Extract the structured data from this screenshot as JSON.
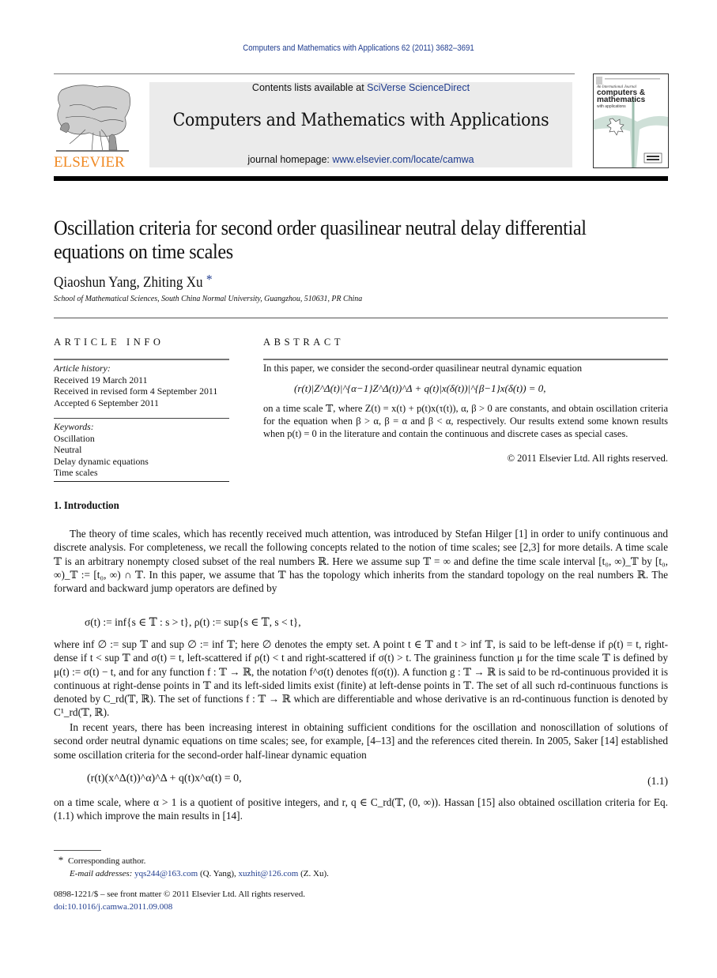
{
  "running_header": "Computers and Mathematics with Applications 62 (2011) 3682–3691",
  "publisher": {
    "logo_word": "ELSEVIER",
    "logo_color": "#f08a24"
  },
  "banner": {
    "contents_prefix": "Contents lists available at ",
    "contents_link": "SciVerse ScienceDirect",
    "journal_title": "Computers and Mathematics with Applications",
    "homepage_prefix": "journal homepage: ",
    "homepage_link": "www.elsevier.com/locate/camwa",
    "link_color": "#1f3c8f"
  },
  "cover": {
    "line1": "An International Journal",
    "line2": "computers &",
    "line3": "mathematics",
    "line4": "with applications",
    "badge": "ELECTRONIC ACCESS"
  },
  "article": {
    "title": "Oscillation criteria for second order quasilinear neutral delay differential equations on time scales",
    "authors": "Qiaoshun Yang, Zhiting Xu",
    "author_mark": "*",
    "affiliation": "School of Mathematical Sciences, South China Normal University, Guangzhou, 510631, PR China"
  },
  "article_info": {
    "heading": "ARTICLE INFO",
    "history_label": "Article history:",
    "history": [
      "Received 19 March 2011",
      "Received in revised form 4 September 2011",
      "Accepted 6 September 2011"
    ],
    "keywords_label": "Keywords:",
    "keywords": [
      "Oscillation",
      "Neutral",
      "Delay dynamic equations",
      "Time scales"
    ]
  },
  "abstract": {
    "heading": "ABSTRACT",
    "intro": "In this paper, we consider the second-order quasilinear neutral dynamic equation",
    "equation": "(r(t)|Z^Δ(t)|^{α−1}Z^Δ(t))^Δ + q(t)|x(δ(t))|^{β−1}x(δ(t)) = 0,",
    "body": "on a time scale 𝕋, where Z(t) = x(t) + p(t)x(τ(t)), α, β > 0 are constants, and obtain oscillation criteria for the equation when β > α, β = α and β < α, respectively. Our results extend some known results when p(t) = 0 in the literature and contain the continuous and discrete cases as special cases.",
    "copyright": "© 2011 Elsevier Ltd. All rights reserved."
  },
  "introduction": {
    "heading": "1.  Introduction",
    "para1": "The theory of time scales, which has recently received much attention, was introduced by Stefan Hilger [1] in order to unify continuous and discrete analysis. For completeness, we recall the following concepts related to the notion of time scales; see [2,3] for more details. A time scale 𝕋 is an arbitrary nonempty closed subset of the real numbers ℝ. Here we assume sup 𝕋 = ∞ and define the time scale interval [t₀, ∞)_𝕋 by [t₀, ∞)_𝕋 := [t₀, ∞) ∩ 𝕋. In this paper, we assume that 𝕋 has the topology which inherits from the standard topology on the real numbers ℝ. The forward and backward jump operators are defined by",
    "jump_equation": "σ(t) := inf{s ∈ 𝕋 : s > t},        ρ(t) := sup{s ∈ 𝕋, s < t},",
    "para2": "where inf ∅ := sup 𝕋 and sup ∅ := inf 𝕋; here ∅ denotes the empty set. A point t ∈ 𝕋 and t > inf 𝕋, is said to be left-dense if ρ(t) = t, right-dense if t < sup 𝕋 and σ(t) = t, left-scattered if ρ(t) < t and right-scattered if σ(t) > t. The graininess function μ for the time scale 𝕋 is defined by μ(t) := σ(t) − t, and for any function f : 𝕋 → ℝ, the notation f^σ(t) denotes f(σ(t)). A function g : 𝕋 → ℝ is said to be rd-continuous provided it is continuous at right-dense points in 𝕋 and its left-sided limits exist (finite) at left-dense points in 𝕋. The set of all such rd-continuous functions is denoted by C_rd(𝕋, ℝ). The set of functions f : 𝕋 → ℝ which are differentiable and whose derivative is an rd-continuous function is denoted by C¹_rd(𝕋, ℝ).",
    "para3": "In recent years, there has been increasing interest in obtaining sufficient conditions for the oscillation and nonoscillation of solutions of second order neutral dynamic equations on time scales; see, for example, [4–13] and the references cited therein. In 2005, Saker [14] established some oscillation criteria for the second-order half-linear dynamic equation",
    "equation_1_1": "(r(t)(x^Δ(t))^α)^Δ + q(t)x^α(t) = 0,",
    "equation_1_1_number": "(1.1)",
    "para4": "on a time scale, where α > 1 is a quotient of positive integers, and r, q ∈ C_rd(𝕋, (0, ∞)). Hassan [15] also obtained oscillation criteria for Eq. (1.1) which improve the main results in [14]."
  },
  "footnotes": {
    "corresponding_mark": "*",
    "corresponding": "Corresponding author.",
    "email_label": "E-mail addresses:",
    "emails": [
      {
        "address": "yqs244@163.com",
        "who": "(Q. Yang),"
      },
      {
        "address": "xuzhit@126.com",
        "who": "(Z. Xu)."
      }
    ],
    "issn": "0898-1221/$ – see front matter © 2011 Elsevier Ltd. All rights reserved.",
    "doi": "doi:10.1016/j.camwa.2011.09.008"
  }
}
